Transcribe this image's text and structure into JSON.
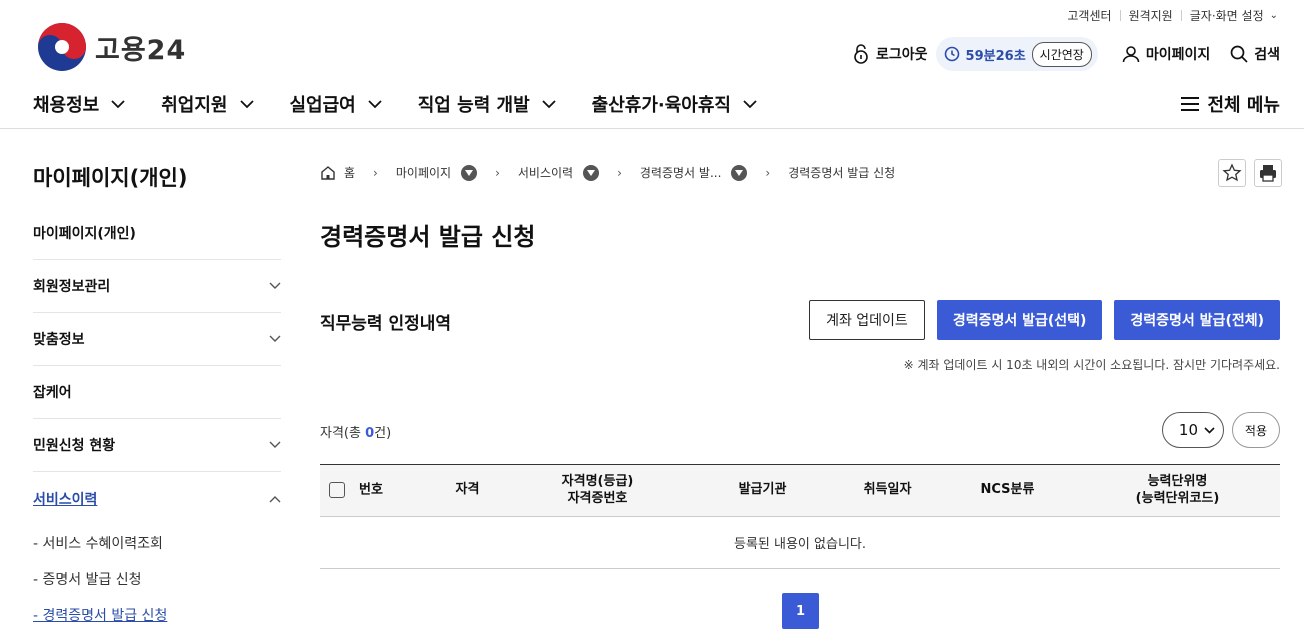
{
  "util": {
    "customer_center": "고객센터",
    "remote_support": "원격지원",
    "display_settings": "글자·화면 설정"
  },
  "brand": {
    "name": "고용24"
  },
  "header": {
    "logout": "로그아웃",
    "timer": "59분26초",
    "extend": "시간연장",
    "mypage": "마이페이지",
    "search": "검색",
    "accent": "#3b5bd6"
  },
  "gnb": {
    "items": [
      {
        "label": "채용정보"
      },
      {
        "label": "취업지원"
      },
      {
        "label": "실업급여"
      },
      {
        "label": "직업 능력 개발"
      },
      {
        "label": "출산휴가·육아휴직"
      }
    ],
    "all_menu": "전체 메뉴"
  },
  "sidebar": {
    "title": "마이페이지(개인)",
    "items": [
      {
        "label": "마이페이지(개인)"
      },
      {
        "label": "회원정보관리"
      },
      {
        "label": "맞춤정보"
      },
      {
        "label": "잡케어"
      },
      {
        "label": "민원신청 현황"
      },
      {
        "label": "서비스이력"
      }
    ],
    "subitems": [
      {
        "label": "- 서비스 수혜이력조회"
      },
      {
        "label": "- 증명서 발급 신청"
      },
      {
        "label": "- 경력증명서 발급 신청"
      }
    ]
  },
  "breadcrumb": {
    "home": "홈",
    "b1": "마이페이지",
    "b2": "서비스이력",
    "b3": "경력증명서 발...",
    "b4": "경력증명서 발급 신청"
  },
  "page": {
    "title": "경력증명서 발급 신청",
    "section_title": "직무능력 인정내역",
    "btn_update": "계좌 업데이트",
    "btn_issue_selected": "경력증명서 발급(선택)",
    "btn_issue_all": "경력증명서 발급(전체)",
    "notice": "※ 계좌 업데이트 시 10초 내외의 시간이 소요됩니다. 잠시만 기다려주세요.",
    "count_prefix": "자격(총 ",
    "count": "0",
    "count_suffix": "건)",
    "per_page": "10",
    "apply": "적용"
  },
  "table": {
    "headers": {
      "no": "번호",
      "qual": "자격",
      "name_l1": "자격명(등급)",
      "name_l2": "자격증번호",
      "issuer": "발급기관",
      "date": "취득일자",
      "ncs": "NCS분류",
      "unit_l1": "능력단위명",
      "unit_l2": "(능력단위코드)"
    },
    "empty": "등록된 내용이 없습니다."
  },
  "pagination": {
    "current": "1"
  }
}
